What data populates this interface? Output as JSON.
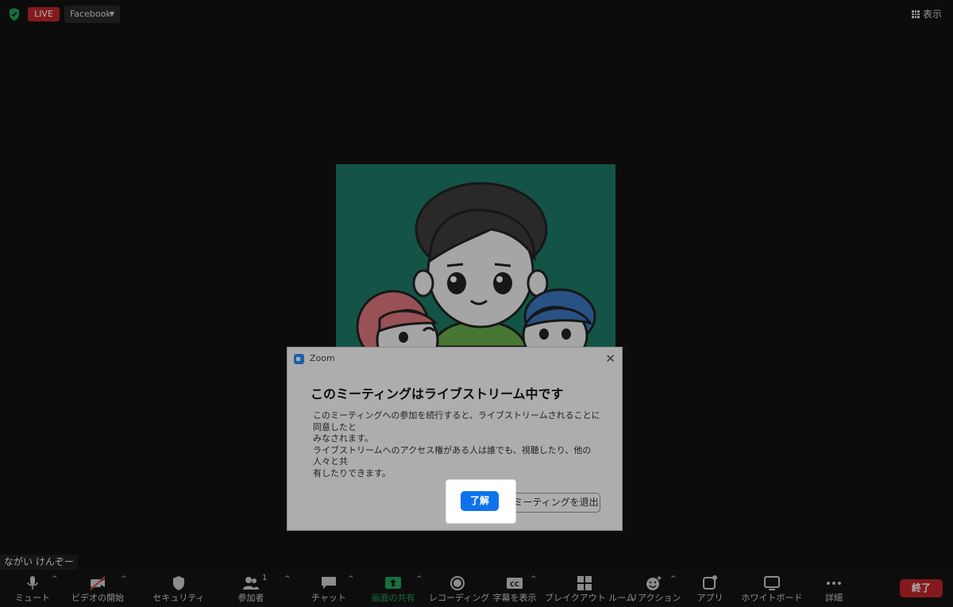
{
  "topbar": {
    "live_badge": "LIVE",
    "stream_target": "Facebook",
    "view_label": "表示"
  },
  "participant": {
    "name": "ながい けんぞー"
  },
  "toolbar": {
    "items": [
      {
        "label": "ミュート",
        "icon": "microphone-icon"
      },
      {
        "label": "ビデオの開始",
        "icon": "video-off-icon"
      },
      {
        "label": "セキュリティ",
        "icon": "shield-icon"
      },
      {
        "label": "参加者",
        "icon": "participants-icon",
        "count": "1"
      },
      {
        "label": "チャット",
        "icon": "chat-icon"
      },
      {
        "label": "画面の共有",
        "icon": "share-screen-icon"
      },
      {
        "label": "レコーディング",
        "icon": "record-icon"
      },
      {
        "label": "字幕を表示",
        "icon": "cc-icon"
      },
      {
        "label": "ブレイクアウト ルーム",
        "icon": "breakout-rooms-icon"
      },
      {
        "label": "リアクション",
        "icon": "reaction-icon"
      },
      {
        "label": "アプリ",
        "icon": "apps-icon"
      },
      {
        "label": "ホワイトボード",
        "icon": "whiteboard-icon"
      },
      {
        "label": "詳細",
        "icon": "more-icon"
      }
    ],
    "end_label": "終了"
  },
  "dialog": {
    "app_name": "Zoom",
    "heading": "このミーティングはライブストリーム中です",
    "body_line1": "このミーティングへの参加を続行すると、ライブストリームされることに同意したと",
    "body_line2": "みなされます。",
    "body_line3": "ライブストリームへのアクセス権がある人は誰でも、視聴したり、他の人々と共",
    "body_line4": "有したりできます。",
    "ok_label": "了解",
    "leave_label": "ミーティングを退出"
  },
  "colors": {
    "background": "#121212",
    "live_red": "#c3272b",
    "share_green": "#23a55a",
    "primary_blue": "#0e72ed",
    "video_bg": "#1d7d69"
  }
}
